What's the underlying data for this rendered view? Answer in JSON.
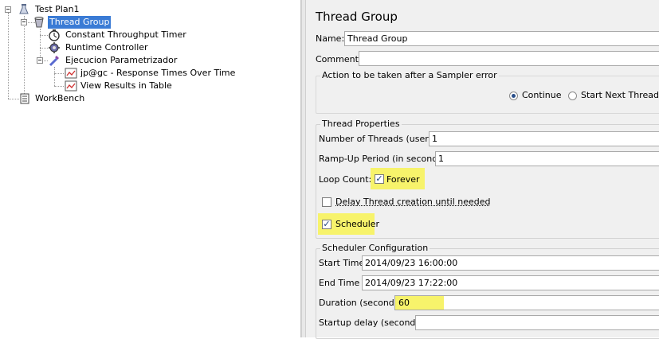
{
  "tree": {
    "items": [
      {
        "label": "Test Plan1",
        "icon": "test-plan-icon"
      },
      {
        "label": "Thread Group",
        "icon": "thread-group-icon"
      },
      {
        "label": "Constant Throughput Timer",
        "icon": "timer-icon"
      },
      {
        "label": "Runtime Controller",
        "icon": "controller-icon"
      },
      {
        "label": "Ejecucion Parametrizador",
        "icon": "pipette-icon"
      },
      {
        "label": "jp@gc - Response Times Over Time",
        "icon": "graph-listener-icon"
      },
      {
        "label": "View Results in Table",
        "icon": "graph-listener-icon"
      },
      {
        "label": "WorkBench",
        "icon": "workbench-icon"
      }
    ]
  },
  "panel": {
    "title": "Thread Group",
    "name_label": "Name:",
    "name_value": "Thread Group",
    "comments_label": "Comments:",
    "comments_value": "",
    "sampler_error": {
      "title": "Action to be taken after a Sampler error",
      "continue_label": "Continue",
      "continue_selected": true,
      "next_loop_label": "Start Next Thread Lo",
      "next_loop_selected": false
    },
    "thread_props": {
      "title": "Thread Properties",
      "threads_label": "Number of Threads (users):",
      "threads_value": "1",
      "rampup_label": "Ramp-Up Period (in seconds):",
      "rampup_value": "1",
      "loop_label": "Loop Count:",
      "forever_label": "Forever",
      "forever_checked": true,
      "delay_label": "Delay Thread creation until needed",
      "delay_checked": false,
      "scheduler_label": "Scheduler",
      "scheduler_checked": true
    },
    "scheduler": {
      "title": "Scheduler Configuration",
      "start_label": "Start Time",
      "start_value": "2014/09/23 16:00:00",
      "end_label": "End Time",
      "end_value": "2014/09/23 17:22:00",
      "duration_label": "Duration (seconds)",
      "duration_value": "60",
      "delay_label": "Startup delay (seconds)",
      "delay_value": ""
    }
  },
  "colors": {
    "selection": "#3a7bd5",
    "highlight": "#f7f36b",
    "panel_bg": "#f0f0f0"
  }
}
